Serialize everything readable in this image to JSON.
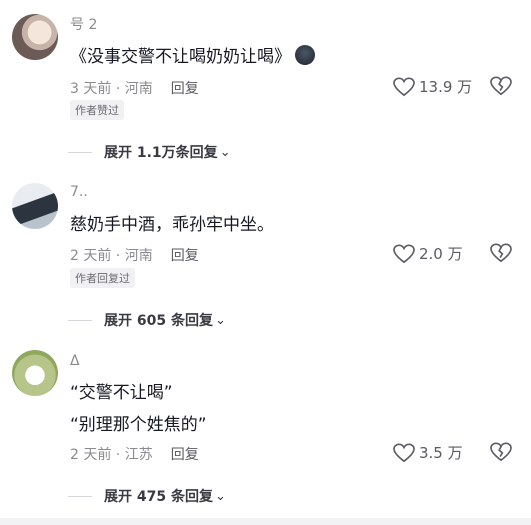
{
  "comments": [
    {
      "username": "号 2",
      "text": "《没事交警不让喝奶奶让喝》",
      "meta": "3 天前 · 河南",
      "reply_label": "回复",
      "badge": "作者赞过",
      "likes": "13.9 万",
      "expand": "展开 1.1万条回复"
    },
    {
      "username": "7..",
      "text": "慈奶手中酒，乖孙牢中坐。",
      "meta": "2 天前 · 河南",
      "reply_label": "回复",
      "badge": "作者回复过",
      "likes": "2.0 万",
      "expand": "展开 605 条回复"
    },
    {
      "username": "Δ",
      "text_line1": "“交警不让喝”",
      "text_line2": "“别理那个姓焦的”",
      "meta": "2 天前 · 江苏",
      "reply_label": "回复",
      "likes": "3.5 万",
      "expand": "展开 475 条回复"
    }
  ],
  "icons": {
    "like": "heart-outline-icon",
    "dislike": "broken-heart-icon",
    "expand": "chevron-down-icon"
  }
}
